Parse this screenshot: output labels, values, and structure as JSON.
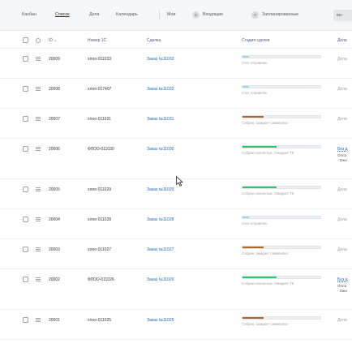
{
  "toolbar": {
    "views": [
      "Канбан",
      "Список",
      "Дела",
      "Календарь"
    ],
    "active_view": "Список",
    "my_label": "Мои:",
    "counters": [
      {
        "count": "0",
        "label": "Входящие"
      },
      {
        "count": "0",
        "label": "Запланированные"
      }
    ],
    "edge_badge": "99+"
  },
  "header": {
    "id": "ID",
    "number_1c": "Номер 1С",
    "deal": "Сделка",
    "stage": "Стадия сделки",
    "activity": "Дела"
  },
  "colors": {
    "stage_blue": "#a7d3f2",
    "stage_green": "#2fc26e",
    "stage_brown": "#a8672c",
    "link": "#2067b0"
  },
  "rows": [
    {
      "id": "20009",
      "number_1c": "хлоо-011033",
      "deal": "Заказ №11033",
      "stage": "Счет отправлен",
      "stage_color": "blue",
      "stage_progress": 0.08,
      "activity": "Дела",
      "activity_link": false,
      "activity_extra": []
    },
    {
      "id": "20008",
      "number_1c": "хлоо-017407",
      "deal": "Заказ №11032",
      "stage": "Счет отправлен",
      "stage_color": "blue",
      "stage_progress": 0.08,
      "activity": "Дела",
      "activity_link": false,
      "activity_extra": []
    },
    {
      "id": "20007",
      "number_1c": "хлоо-011031",
      "deal": "Заказ №11031",
      "stage": "Собран, ожидает самовывоз",
      "stage_color": "brown",
      "stage_progress": 0.27,
      "activity": "Дела",
      "activity_link": false,
      "activity_extra": []
    },
    {
      "id": "20006",
      "number_1c": "ФЛОО-011030",
      "deal": "Заказ №11030",
      "stage": "Собран полностью. Ожидает ТК",
      "stage_color": "green",
      "stage_progress": 0.44,
      "activity": "Без д",
      "activity_link": true,
      "activity_extra": [
        "Опла",
        "- Ожи"
      ]
    },
    {
      "id": "20005",
      "number_1c": "хлоо-011029",
      "deal": "Заказ №11029",
      "stage": "Собран полностью. Ожидает ТК",
      "stage_color": "green",
      "stage_progress": 0.44,
      "activity": "Дела",
      "activity_link": false,
      "activity_extra": []
    },
    {
      "id": "20004",
      "number_1c": "хлоо-011028",
      "deal": "Заказ №11028",
      "stage": "Счет отправлен",
      "stage_color": "blue",
      "stage_progress": 0.08,
      "activity": "Дела",
      "activity_link": false,
      "activity_extra": []
    },
    {
      "id": "20003",
      "number_1c": "хлоо-011027",
      "deal": "Заказ №11027",
      "stage": "Собран, ожидает самовывоз",
      "stage_color": "brown",
      "stage_progress": 0.27,
      "activity": "Дела",
      "activity_link": false,
      "activity_extra": []
    },
    {
      "id": "20002",
      "number_1c": "ФЛОО-011026",
      "deal": "Заказ №11026",
      "stage": "Собран полностью. Ожидает ТК",
      "stage_color": "green",
      "stage_progress": 0.44,
      "activity": "Без д",
      "activity_link": true,
      "activity_extra": [
        "Опла",
        "- Ожи"
      ]
    },
    {
      "id": "20001",
      "number_1c": "хлоо-011025",
      "deal": "Заказ №11025",
      "stage": "Собран, ожидает самовывоз",
      "stage_color": "brown",
      "stage_progress": 0.27,
      "activity": "Дела",
      "activity_link": false,
      "activity_extra": []
    }
  ]
}
